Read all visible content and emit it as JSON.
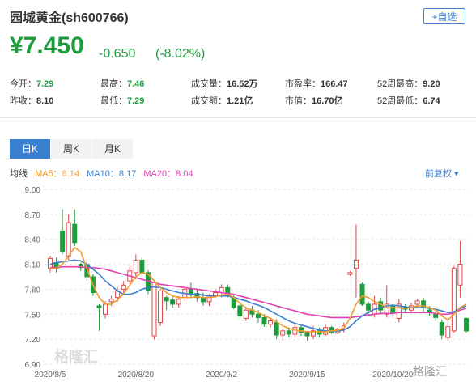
{
  "header": {
    "title": "园城黄金(sh600766)",
    "add_button": "+自选",
    "price": "¥7.450",
    "change": "-0.650",
    "change_pct": "(-8.02%)"
  },
  "stats": {
    "row1": [
      {
        "label": "今开：",
        "value": "7.29",
        "green": true
      },
      {
        "label": "最高：",
        "value": "7.46",
        "green": true
      },
      {
        "label": "成交量：",
        "value": "16.52万",
        "green": false
      },
      {
        "label": "市盈率：",
        "value": "166.47",
        "green": false
      },
      {
        "label": "52周最高：",
        "value": "9.20",
        "green": false
      }
    ],
    "row2": [
      {
        "label": "昨收：",
        "value": "8.10",
        "green": false
      },
      {
        "label": "最低：",
        "value": "7.29",
        "green": true
      },
      {
        "label": "成交额：",
        "value": "1.21亿",
        "green": false
      },
      {
        "label": "市值：",
        "value": "16.70亿",
        "green": false
      },
      {
        "label": "52周最低：",
        "value": "6.74",
        "green": false
      }
    ]
  },
  "tabs": [
    "日K",
    "周K",
    "月K"
  ],
  "ma_legend": {
    "label": "均线",
    "items": [
      {
        "text": "MA5：8.14",
        "color": "#f39c2c"
      },
      {
        "text": "MA10：8.17",
        "color": "#3a7fd0"
      },
      {
        "text": "MA20：8.04",
        "color": "#e23fb1"
      }
    ]
  },
  "adjust_label": "前复权 ▾",
  "watermark": "格隆汇",
  "logo_text": "格隆汇",
  "chart_data": {
    "type": "candlestick",
    "y_ticks": [
      "9.00",
      "8.70",
      "8.40",
      "8.10",
      "7.80",
      "7.50",
      "7.20",
      "6.90"
    ],
    "ylim": [
      6.9,
      9.0
    ],
    "x_tick_labels": [
      "2020/8/5",
      "2020/8/20",
      "2020/9/2",
      "2020/9/15",
      "2020/10/20"
    ],
    "up_color": "#e04545",
    "down_color": "#1e9d3d",
    "candles": [
      [
        8.05,
        8.17,
        8.0,
        8.2
      ],
      [
        8.12,
        8.05,
        8.0,
        8.18
      ],
      [
        8.5,
        8.25,
        8.22,
        8.76
      ],
      [
        8.2,
        8.6,
        8.15,
        8.7
      ],
      [
        8.58,
        8.36,
        8.32,
        8.76
      ],
      [
        8.1,
        8.06,
        8.02,
        8.12
      ],
      [
        8.1,
        7.95,
        7.9,
        8.15
      ],
      [
        7.95,
        7.76,
        7.72,
        7.98
      ],
      [
        7.6,
        7.58,
        7.3,
        7.62
      ],
      [
        7.5,
        7.62,
        7.45,
        7.66
      ],
      [
        7.65,
        7.68,
        7.6,
        7.72
      ],
      [
        7.7,
        7.78,
        7.65,
        7.82
      ],
      [
        7.8,
        7.85,
        7.74,
        7.9
      ],
      [
        7.9,
        8.02,
        7.86,
        8.08
      ],
      [
        8.0,
        8.15,
        7.92,
        8.22
      ],
      [
        8.15,
        8.0,
        7.95,
        8.18
      ],
      [
        8.0,
        7.78,
        7.74,
        8.03
      ],
      [
        7.24,
        7.88,
        7.2,
        7.9
      ],
      [
        7.4,
        7.78,
        7.36,
        7.8
      ],
      [
        7.7,
        7.66,
        7.55,
        7.72
      ],
      [
        7.67,
        7.62,
        7.58,
        7.72
      ],
      [
        7.62,
        7.68,
        7.58,
        7.72
      ],
      [
        7.7,
        7.8,
        7.66,
        7.84
      ],
      [
        7.8,
        7.75,
        7.7,
        7.88
      ],
      [
        7.75,
        7.7,
        7.65,
        7.8
      ],
      [
        7.7,
        7.65,
        7.6,
        7.76
      ],
      [
        7.65,
        7.72,
        7.6,
        7.74
      ],
      [
        7.72,
        7.76,
        7.7,
        7.8
      ],
      [
        7.76,
        7.82,
        7.7,
        7.86
      ],
      [
        7.82,
        7.74,
        7.7,
        7.86
      ],
      [
        7.7,
        7.58,
        7.56,
        7.74
      ],
      [
        7.6,
        7.48,
        7.44,
        7.62
      ],
      [
        7.45,
        7.55,
        7.42,
        7.58
      ],
      [
        7.55,
        7.5,
        7.46,
        7.6
      ],
      [
        7.5,
        7.46,
        7.4,
        7.55
      ],
      [
        7.46,
        7.38,
        7.35,
        7.5
      ],
      [
        7.38,
        7.42,
        7.34,
        7.46
      ],
      [
        7.4,
        7.25,
        7.2,
        7.44
      ],
      [
        7.25,
        7.3,
        7.18,
        7.32
      ],
      [
        7.3,
        7.26,
        7.22,
        7.34
      ],
      [
        7.26,
        7.34,
        7.22,
        7.38
      ],
      [
        7.34,
        7.28,
        7.24,
        7.38
      ],
      [
        7.28,
        7.24,
        7.18,
        7.3
      ],
      [
        7.24,
        7.3,
        7.2,
        7.36
      ],
      [
        7.3,
        7.26,
        7.22,
        7.34
      ],
      [
        7.26,
        7.34,
        7.24,
        7.38
      ],
      [
        7.34,
        7.28,
        7.26,
        7.36
      ],
      [
        7.28,
        7.32,
        7.26,
        7.34
      ],
      [
        7.32,
        7.36,
        7.28,
        7.4
      ],
      [
        7.98,
        8.0,
        7.96,
        8.02
      ],
      [
        8.05,
        8.15,
        7.7,
        8.58
      ],
      [
        7.86,
        7.62,
        7.6,
        7.88
      ],
      [
        7.62,
        7.55,
        7.5,
        7.65
      ],
      [
        7.5,
        7.62,
        7.46,
        7.72
      ],
      [
        7.65,
        7.55,
        7.5,
        7.7
      ],
      [
        7.5,
        7.62,
        7.46,
        7.85
      ],
      [
        7.6,
        7.52,
        7.46,
        7.62
      ],
      [
        7.45,
        7.62,
        7.4,
        7.68
      ],
      [
        7.58,
        7.56,
        7.52,
        7.62
      ],
      [
        7.55,
        7.6,
        7.52,
        7.64
      ],
      [
        7.62,
        7.66,
        7.58,
        7.68
      ],
      [
        7.66,
        7.58,
        7.52,
        7.7
      ],
      [
        7.55,
        7.52,
        7.48,
        7.6
      ],
      [
        7.5,
        7.46,
        7.42,
        7.56
      ],
      [
        7.4,
        7.25,
        7.2,
        7.44
      ],
      [
        7.22,
        7.35,
        7.18,
        7.42
      ],
      [
        7.3,
        8.05,
        7.28,
        8.08
      ],
      [
        7.85,
        8.1,
        7.7,
        8.38
      ],
      [
        7.45,
        7.3,
        7.28,
        7.46
      ]
    ],
    "ma5": [
      8.05,
      8.05,
      8.1,
      8.2,
      8.3,
      8.25,
      8.05,
      7.85,
      7.7,
      7.62,
      7.62,
      7.67,
      7.75,
      7.85,
      7.95,
      8.0,
      7.98,
      7.9,
      7.82,
      7.76,
      7.72,
      7.7,
      7.7,
      7.7,
      7.71,
      7.7,
      7.7,
      7.71,
      7.73,
      7.74,
      7.7,
      7.63,
      7.58,
      7.55,
      7.52,
      7.48,
      7.45,
      7.41,
      7.36,
      7.33,
      7.31,
      7.3,
      7.29,
      7.29,
      7.29,
      7.29,
      7.3,
      7.31,
      7.33,
      7.45,
      7.62,
      7.72,
      7.7,
      7.65,
      7.62,
      7.58,
      7.58,
      7.58,
      7.57,
      7.58,
      7.6,
      7.6,
      7.58,
      7.55,
      7.48,
      7.43,
      7.5,
      7.58,
      7.62
    ],
    "ma10": [
      8.1,
      8.12,
      8.13,
      8.14,
      8.15,
      8.14,
      8.1,
      8.04,
      7.98,
      7.9,
      7.84,
      7.78,
      7.74,
      7.74,
      7.76,
      7.8,
      7.82,
      7.83,
      7.82,
      7.8,
      7.78,
      7.76,
      7.75,
      7.74,
      7.74,
      7.73,
      7.72,
      7.72,
      7.72,
      7.72,
      7.7,
      7.68,
      7.66,
      7.63,
      7.61,
      7.58,
      7.54,
      7.5,
      7.46,
      7.42,
      7.39,
      7.37,
      7.35,
      7.33,
      7.31,
      7.3,
      7.3,
      7.3,
      7.31,
      7.35,
      7.42,
      7.48,
      7.52,
      7.56,
      7.58,
      7.6,
      7.61,
      7.6,
      7.59,
      7.58,
      7.58,
      7.58,
      7.57,
      7.56,
      7.54,
      7.52,
      7.53,
      7.57,
      7.6
    ],
    "ma20": [
      8.06,
      8.06,
      8.07,
      8.07,
      8.07,
      8.07,
      8.06,
      8.06,
      8.05,
      8.04,
      8.02,
      8.0,
      7.98,
      7.96,
      7.94,
      7.92,
      7.9,
      7.88,
      7.86,
      7.85,
      7.84,
      7.83,
      7.82,
      7.81,
      7.8,
      7.79,
      7.78,
      7.77,
      7.76,
      7.75,
      7.74,
      7.72,
      7.7,
      7.68,
      7.66,
      7.64,
      7.62,
      7.6,
      7.58,
      7.56,
      7.54,
      7.52,
      7.5,
      7.49,
      7.48,
      7.47,
      7.46,
      7.46,
      7.46,
      7.46,
      7.47,
      7.48,
      7.49,
      7.5,
      7.51,
      7.51,
      7.51,
      7.52,
      7.52,
      7.52,
      7.52,
      7.52,
      7.52,
      7.51,
      7.5,
      7.5,
      7.52,
      7.55,
      7.57
    ]
  }
}
